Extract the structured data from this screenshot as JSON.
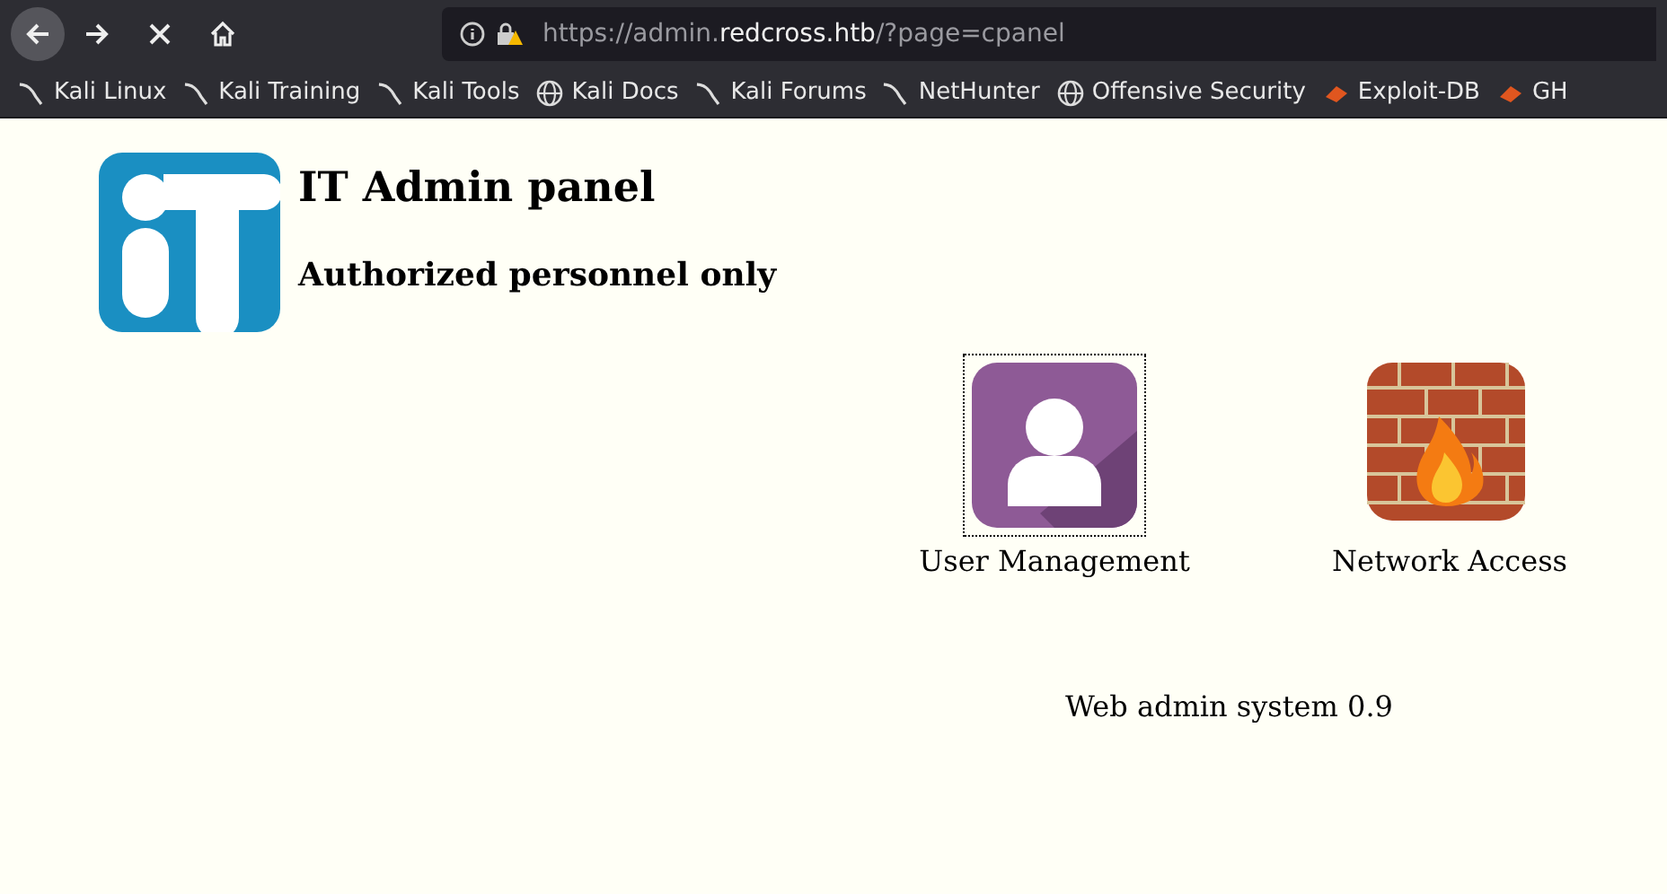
{
  "browser": {
    "url_parts": [
      {
        "text": "https://admin.",
        "highlighted": false
      },
      {
        "text": "redcross.htb",
        "highlighted": true
      },
      {
        "text": "/?page=cpanel",
        "highlighted": false
      }
    ],
    "bookmarks": [
      {
        "label": "Kali Linux",
        "kind": "kali"
      },
      {
        "label": "Kali Training",
        "kind": "kali"
      },
      {
        "label": "Kali Tools",
        "kind": "kali"
      },
      {
        "label": "Kali Docs",
        "kind": "globe"
      },
      {
        "label": "Kali Forums",
        "kind": "kali"
      },
      {
        "label": "NetHunter",
        "kind": "kali"
      },
      {
        "label": "Offensive Security",
        "kind": "globe"
      },
      {
        "label": "Exploit-DB",
        "kind": "exploit"
      },
      {
        "label": "GH",
        "kind": "exploit"
      }
    ]
  },
  "page": {
    "title": "IT Admin panel",
    "subtitle": "Authorized personnel only",
    "apps": [
      {
        "label": "User Management",
        "kind": "users",
        "focused": true
      },
      {
        "label": "Network Access",
        "kind": "firewall",
        "focused": false
      }
    ],
    "footer": "Web admin system 0.9"
  }
}
